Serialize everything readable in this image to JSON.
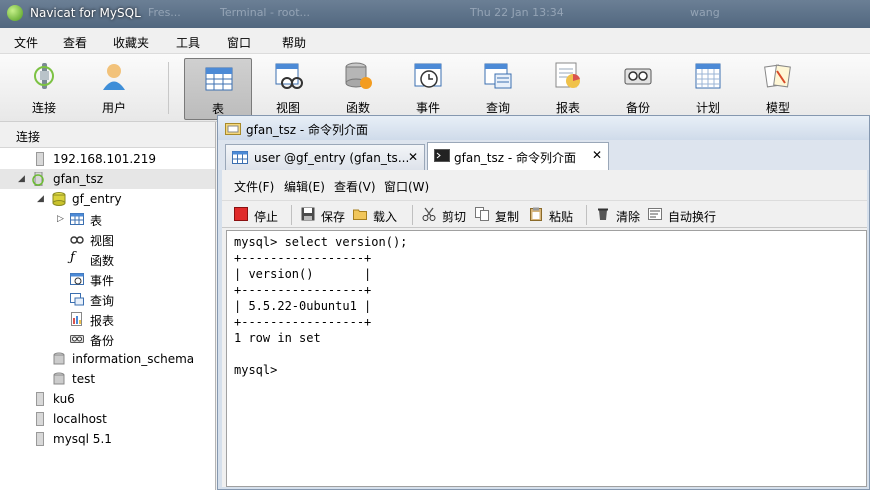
{
  "window": {
    "title": "Navicat for MySQL",
    "ghost_tabs": [
      "Fres...",
      "Terminal - root...",
      "Thu 22 Jan 13:34",
      "wang"
    ]
  },
  "menubar": [
    "文件",
    "查看",
    "收藏夹",
    "工具",
    "窗口",
    "帮助"
  ],
  "toolbar": {
    "items": [
      {
        "label": "连接",
        "icon": "connection-plug-icon"
      },
      {
        "label": "用户",
        "icon": "user-icon"
      },
      {
        "label": "表",
        "icon": "table-icon",
        "active": true
      },
      {
        "label": "视图",
        "icon": "view-icon"
      },
      {
        "label": "函数",
        "icon": "function-icon"
      },
      {
        "label": "事件",
        "icon": "event-clock-icon"
      },
      {
        "label": "查询",
        "icon": "query-icon"
      },
      {
        "label": "报表",
        "icon": "report-icon"
      },
      {
        "label": "备份",
        "icon": "backup-icon"
      },
      {
        "label": "计划",
        "icon": "schedule-icon"
      },
      {
        "label": "模型",
        "icon": "model-icon"
      }
    ]
  },
  "sidebar": {
    "header": "连接",
    "items": [
      {
        "label": "192.168.101.219",
        "icon": "server-icon"
      },
      {
        "label": "gfan_tsz",
        "icon": "server-connected-icon",
        "expanded": true
      },
      {
        "label": "gf_entry",
        "icon": "database-icon",
        "expanded": true
      },
      {
        "label": "表",
        "icon": "table-icon"
      },
      {
        "label": "视图",
        "icon": "view-glasses-icon"
      },
      {
        "label": "函数",
        "icon": "function-icon"
      },
      {
        "label": "事件",
        "icon": "event-icon"
      },
      {
        "label": "查询",
        "icon": "query-icon"
      },
      {
        "label": "报表",
        "icon": "report-icon"
      },
      {
        "label": "备份",
        "icon": "backup-icon"
      },
      {
        "label": "information_schema",
        "icon": "database-gray-icon"
      },
      {
        "label": "test",
        "icon": "database-gray-icon"
      },
      {
        "label": "ku6",
        "icon": "server-icon"
      },
      {
        "label": "localhost",
        "icon": "server-icon"
      },
      {
        "label": "mysql 5.1",
        "icon": "server-icon"
      }
    ]
  },
  "inner_window": {
    "title": "gfan_tsz - 命令列介面",
    "tabs": [
      {
        "label": "user @gf_entry (gfan_ts...",
        "close": "✕"
      },
      {
        "label": "gfan_tsz - 命令列介面",
        "close": "✕",
        "active": true
      }
    ],
    "menu": [
      "文件(F)",
      "编辑(E)",
      "查看(V)",
      "窗口(W)"
    ],
    "toolbar": [
      {
        "label": "停止",
        "icon": "stop-icon"
      },
      {
        "label": "保存",
        "icon": "save-icon"
      },
      {
        "label": "载入",
        "icon": "open-folder-icon"
      },
      {
        "label": "剪切",
        "icon": "cut-icon"
      },
      {
        "label": "复制",
        "icon": "copy-icon"
      },
      {
        "label": "粘贴",
        "icon": "paste-icon"
      },
      {
        "label": "清除",
        "icon": "clear-icon"
      },
      {
        "label": "自动换行",
        "icon": "wrap-icon"
      }
    ],
    "console_lines": [
      "mysql> select version();",
      "+-----------------+",
      "| version()       |",
      "+-----------------+",
      "| 5.5.22-0ubuntu1 |",
      "+-----------------+",
      "1 row in set",
      "",
      "mysql>"
    ]
  }
}
